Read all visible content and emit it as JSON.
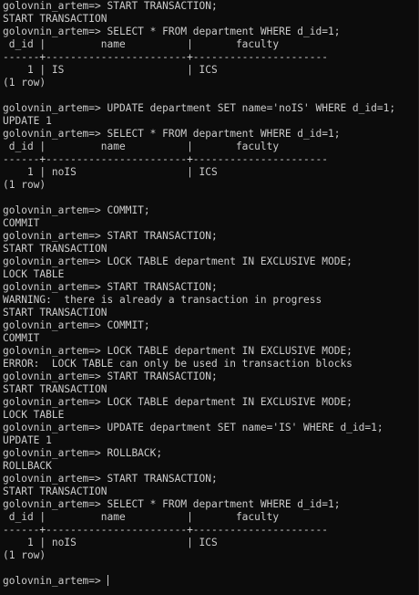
{
  "terminal": {
    "lines": [
      "golovnin_artem=> START TRANSACTION;",
      "START TRANSACTION",
      "golovnin_artem=> SELECT * FROM department WHERE d_id=1;",
      " d_id |         name          |       faculty",
      "------+-----------------------+----------------------",
      "    1 | IS                    | ICS",
      "(1 row)",
      "",
      "golovnin_artem=> UPDATE department SET name='noIS' WHERE d_id=1;",
      "UPDATE 1",
      "golovnin_artem=> SELECT * FROM department WHERE d_id=1;",
      " d_id |         name          |       faculty",
      "------+-----------------------+----------------------",
      "    1 | noIS                  | ICS",
      "(1 row)",
      "",
      "golovnin_artem=> COMMIT;",
      "COMMIT",
      "golovnin_artem=> START TRANSACTION;",
      "START TRANSACTION",
      "golovnin_artem=> LOCK TABLE department IN EXCLUSIVE MODE;",
      "LOCK TABLE",
      "golovnin_artem=> START TRANSACTION;",
      "WARNING:  there is already a transaction in progress",
      "START TRANSACTION",
      "golovnin_artem=> COMMIT;",
      "COMMIT",
      "golovnin_artem=> LOCK TABLE department IN EXCLUSIVE MODE;",
      "ERROR:  LOCK TABLE can only be used in transaction blocks",
      "golovnin_artem=> START TRANSACTION;",
      "START TRANSACTION",
      "golovnin_artem=> LOCK TABLE department IN EXCLUSIVE MODE;",
      "LOCK TABLE",
      "golovnin_artem=> UPDATE department SET name='IS' WHERE d_id=1;",
      "UPDATE 1",
      "golovnin_artem=> ROLLBACK;",
      "ROLLBACK",
      "golovnin_artem=> START TRANSACTION;",
      "START TRANSACTION",
      "golovnin_artem=> SELECT * FROM department WHERE d_id=1;",
      " d_id |         name          |       faculty",
      "------+-----------------------+----------------------",
      "    1 | noIS                  | ICS",
      "(1 row)",
      "",
      "golovnin_artem=> "
    ]
  }
}
